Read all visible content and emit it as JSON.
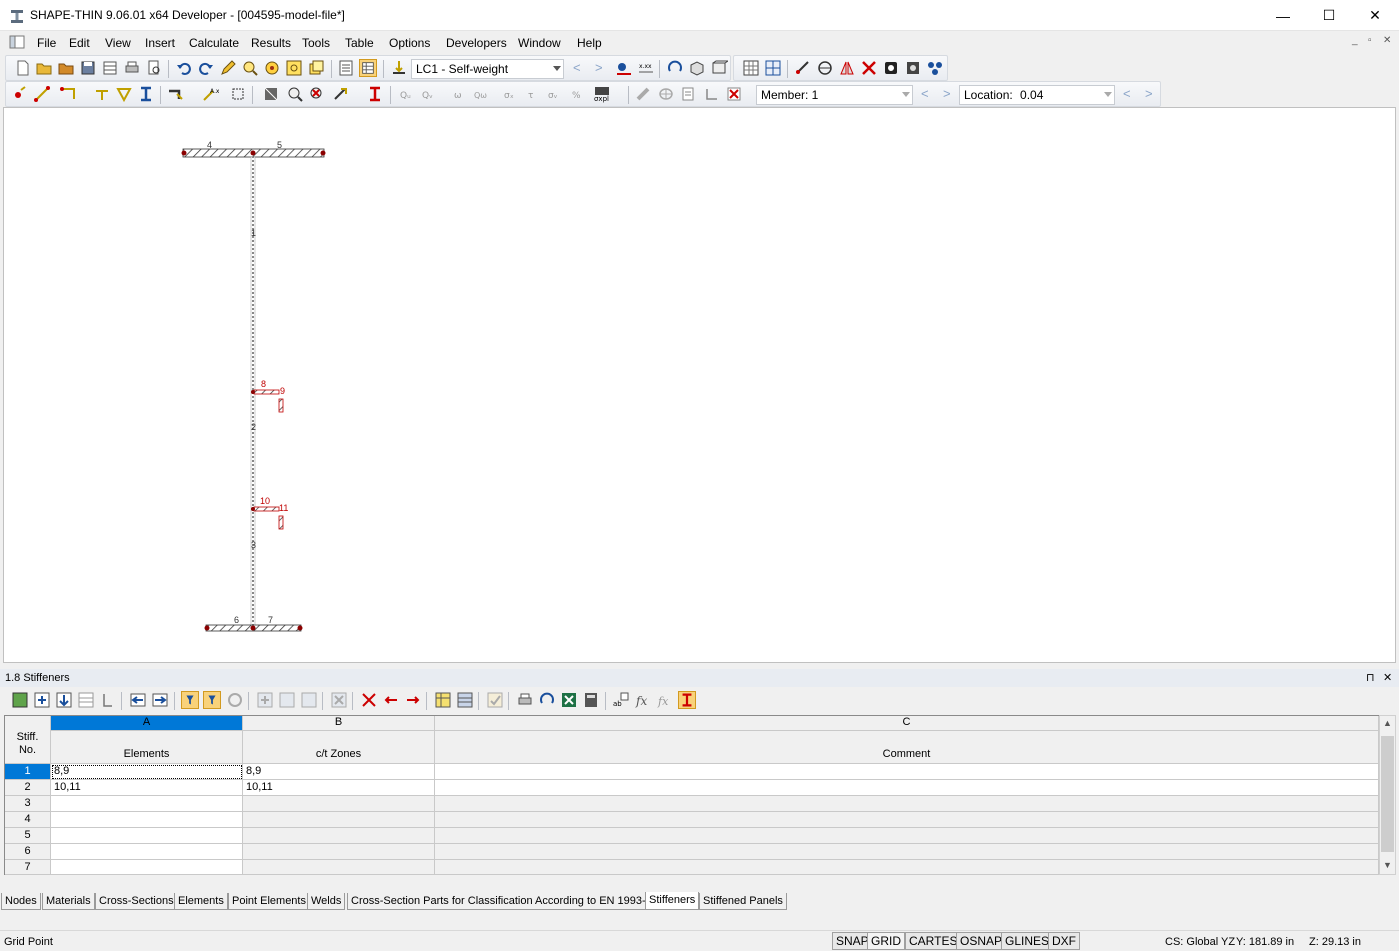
{
  "window": {
    "title": "SHAPE-THIN 9.06.01 x64 Developer - [004595-model-file*]",
    "minimize": "—",
    "maximize": "☐",
    "close": "✕"
  },
  "menu": [
    "File",
    "Edit",
    "View",
    "Insert",
    "Calculate",
    "Results",
    "Tools",
    "Table",
    "Options",
    "Developers",
    "Window",
    "Help"
  ],
  "toolbar": {
    "load_case": "LC1 - Self-weight",
    "member_label": "Member: 1",
    "location_label": "Location:",
    "location_value": "0.04"
  },
  "model": {
    "element_labels": [
      "1",
      "2",
      "3"
    ],
    "node_labels": [
      "4",
      "5",
      "6",
      "7",
      "8",
      "9",
      "10",
      "11"
    ]
  },
  "panel": {
    "title": "1.8 Stiffeners",
    "pin": "⊓",
    "close": "✕"
  },
  "table": {
    "row_header": "Stiff. No.",
    "columns": [
      {
        "letter": "A",
        "name": "Elements"
      },
      {
        "letter": "B",
        "name": "c/t Zones"
      },
      {
        "letter": "C",
        "name": "Comment"
      }
    ],
    "rows": [
      {
        "no": "1",
        "elements": "8,9",
        "ct_zones": "8,9",
        "comment": ""
      },
      {
        "no": "2",
        "elements": "10,11",
        "ct_zones": "10,11",
        "comment": ""
      },
      {
        "no": "3",
        "elements": "",
        "ct_zones": "",
        "comment": ""
      },
      {
        "no": "4",
        "elements": "",
        "ct_zones": "",
        "comment": ""
      },
      {
        "no": "5",
        "elements": "",
        "ct_zones": "",
        "comment": ""
      },
      {
        "no": "6",
        "elements": "",
        "ct_zones": "",
        "comment": ""
      },
      {
        "no": "7",
        "elements": "",
        "ct_zones": "",
        "comment": ""
      }
    ]
  },
  "tabs": [
    "Nodes",
    "Materials",
    "Cross-Sections",
    "Elements",
    "Point Elements",
    "Welds",
    "Cross-Section Parts for Classification According to EN 1993-1",
    "Stiffeners",
    "Stiffened Panels"
  ],
  "active_tab": "Stiffeners",
  "status": {
    "left": "Grid Point",
    "buttons": [
      "SNAP",
      "GRID",
      "CARTES",
      "OSNAP",
      "GLINES",
      "DXF"
    ],
    "cs": "CS: Global YZ",
    "y": "Y:  181.89 in",
    "z": "Z:  29.13 in"
  },
  "colors": {
    "accent": "#0078d7",
    "selection": "#0a64d8",
    "stiffener": "#c00000",
    "element": "#7a7a7a"
  }
}
